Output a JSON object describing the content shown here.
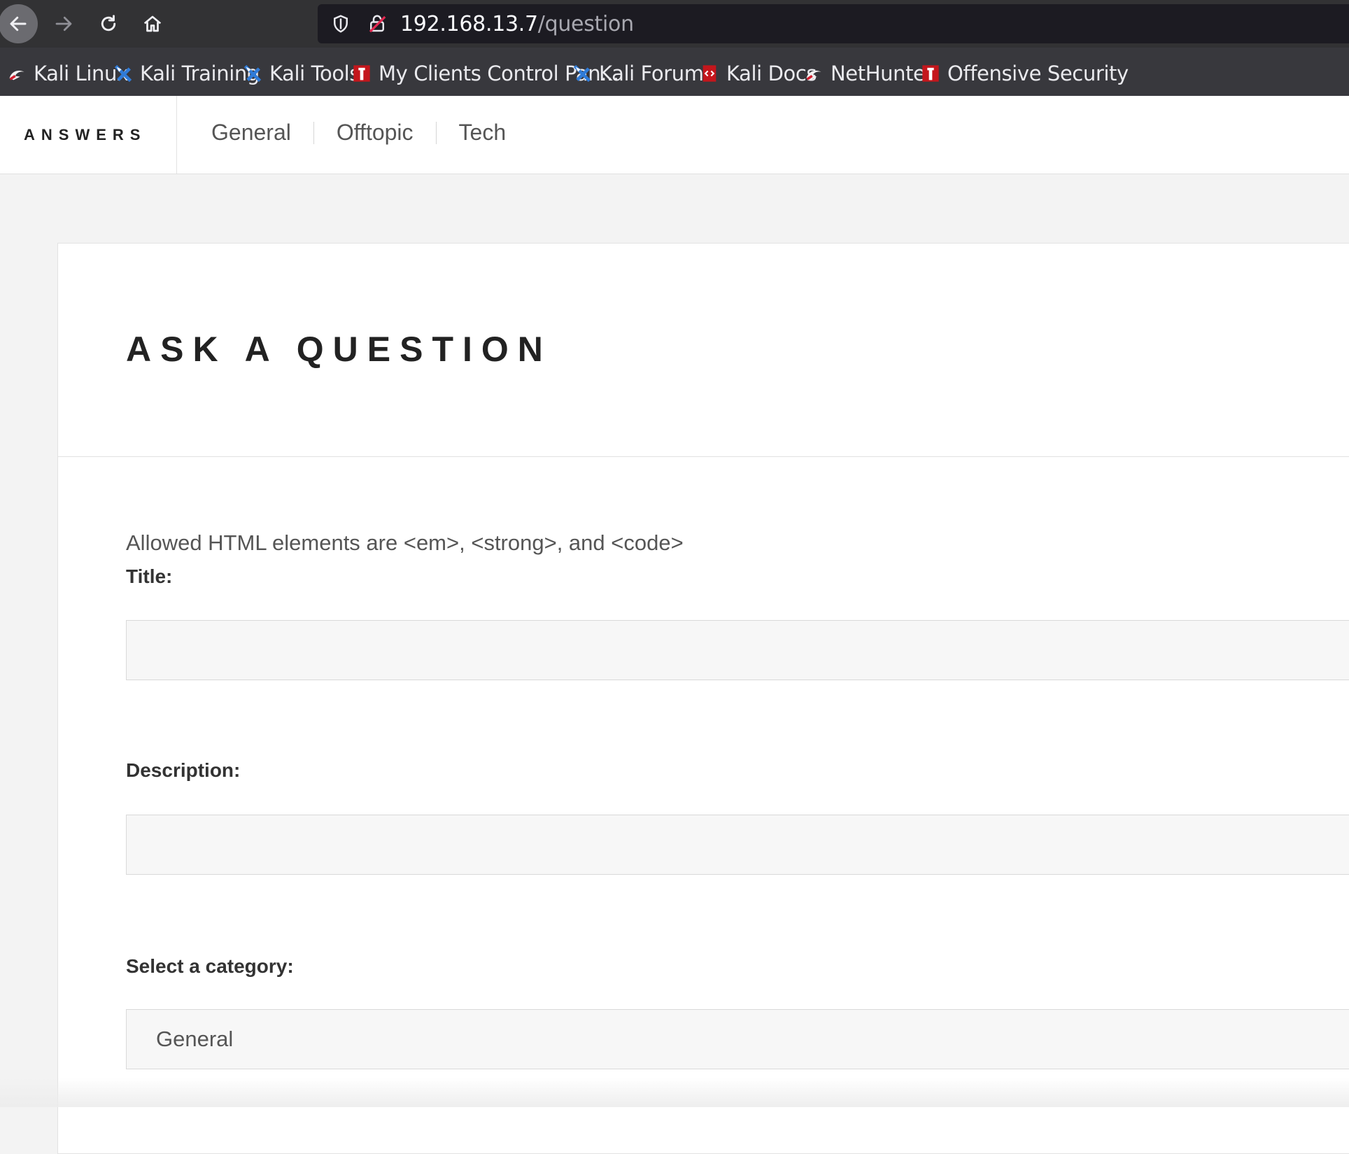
{
  "browser": {
    "url_host": "192.168.13.7",
    "url_path": "/question",
    "bookmarks": [
      {
        "label": "Kali Linux",
        "icon": "kali-dragon-icon"
      },
      {
        "label": "Kali Training",
        "icon": "kali-training-icon"
      },
      {
        "label": "Kali Tools",
        "icon": "kali-tools-icon"
      },
      {
        "label": "My Clients Control Pan...",
        "icon": "offsec-icon"
      },
      {
        "label": "Kali Forums",
        "icon": "kali-forums-icon"
      },
      {
        "label": "Kali Docs",
        "icon": "kali-docs-icon"
      },
      {
        "label": "NetHunter",
        "icon": "nethunter-icon"
      },
      {
        "label": "Offensive Security",
        "icon": "offsec-icon"
      }
    ]
  },
  "site": {
    "brand": "ANSWERS",
    "nav": [
      "General",
      "Offtopic",
      "Tech"
    ]
  },
  "form": {
    "title": "ASK A QUESTION",
    "hint": "Allowed HTML elements are <em>, <strong>, and <code>",
    "title_label": "Title:",
    "title_value": "",
    "description_label": "Description:",
    "description_value": "",
    "category_label": "Select a category:",
    "category_selected": "General"
  },
  "colors": {
    "chrome_bg": "#38383d",
    "urlbar_bg": "#1c1b22",
    "page_bg": "#f3f3f3",
    "field_bg": "#f7f7f7",
    "kali_blue": "#2f7bd8",
    "offsec_red": "#c4161c"
  }
}
